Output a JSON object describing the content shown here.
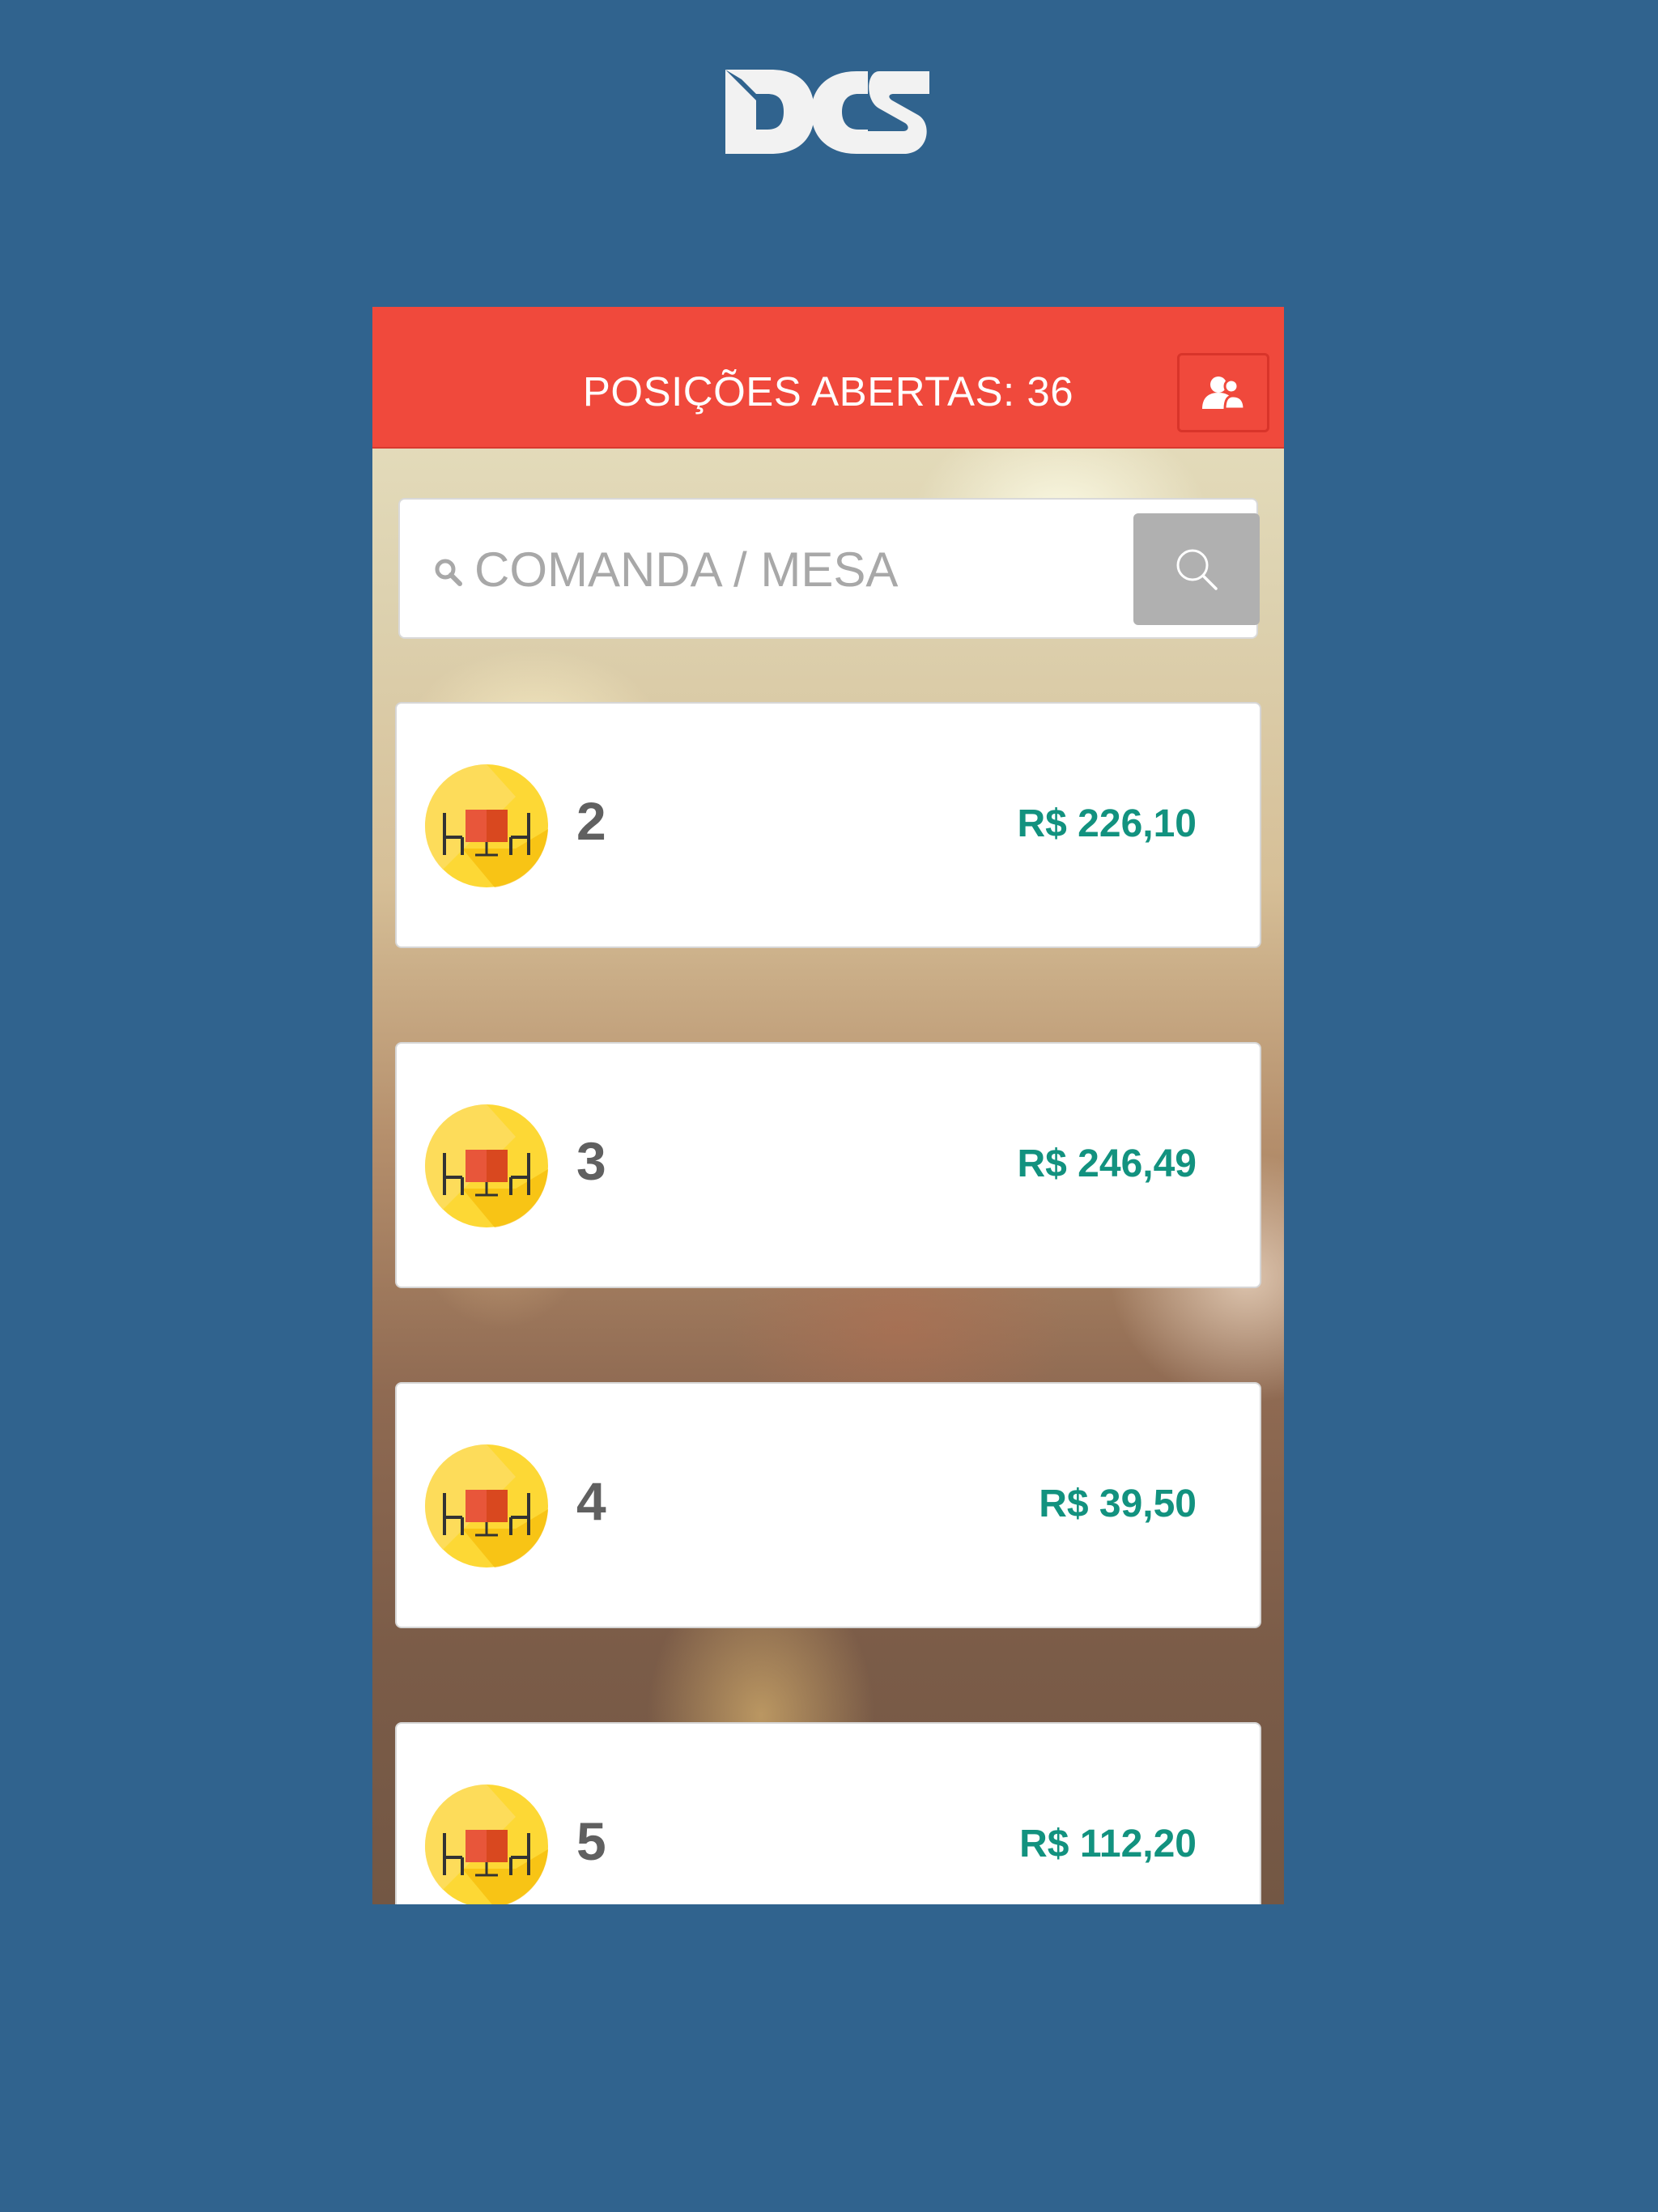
{
  "app": {
    "logo_text": "DCS"
  },
  "header": {
    "title": "POSIÇÕES ABERTAS: 36",
    "users_button_icon": "users-icon"
  },
  "search": {
    "placeholder": "COMANDA / MESA",
    "value": "",
    "leading_icon": "search-icon",
    "button_icon": "search-icon"
  },
  "positions": [
    {
      "number": "2",
      "value": "R$ 226,10",
      "icon": "dining-table-icon"
    },
    {
      "number": "3",
      "value": "R$ 246,49",
      "icon": "dining-table-icon"
    },
    {
      "number": "4",
      "value": "R$ 39,50",
      "icon": "dining-table-icon"
    },
    {
      "number": "5",
      "value": "R$ 112,20",
      "icon": "dining-table-icon"
    }
  ],
  "colors": {
    "page_background": "#30638e",
    "header": "#f0493c",
    "price": "#12927f",
    "search_button": "#b0b0b0",
    "icon_circle": "#fdd835"
  }
}
